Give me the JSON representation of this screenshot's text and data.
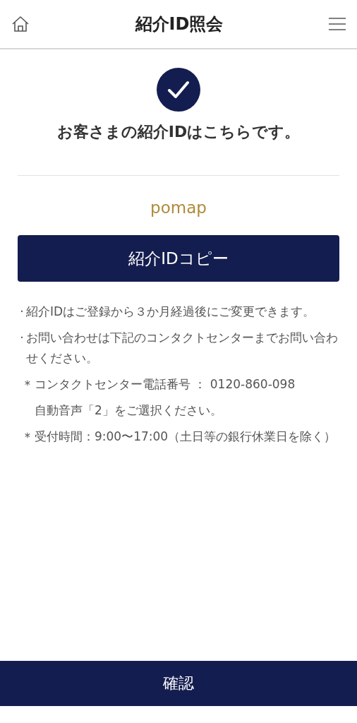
{
  "header": {
    "title": "紹介ID照会"
  },
  "message": "お客さまの紹介IDはこちらです。",
  "referral_id": "pomap",
  "copy_button": "紹介IDコピー",
  "notes": [
    {
      "kind": "dot",
      "marker": "·",
      "text": "紹介IDはご登録から３か月経過後にご変更できます。"
    },
    {
      "kind": "dot",
      "marker": "·",
      "text": "お問い合わせは下記のコンタクトセンターまでお問い合わせください。"
    },
    {
      "kind": "asterisk",
      "marker": "＊",
      "text": "コンタクトセンター電話番号 ： 0120-860-098"
    },
    {
      "kind": "plain",
      "text": "自動音声「2」をご選択ください。"
    },
    {
      "kind": "asterisk",
      "marker": "＊",
      "text": "受付時間：9:00〜17:00（土日等の銀行休業日を除く）"
    }
  ],
  "confirm_button": "確認"
}
